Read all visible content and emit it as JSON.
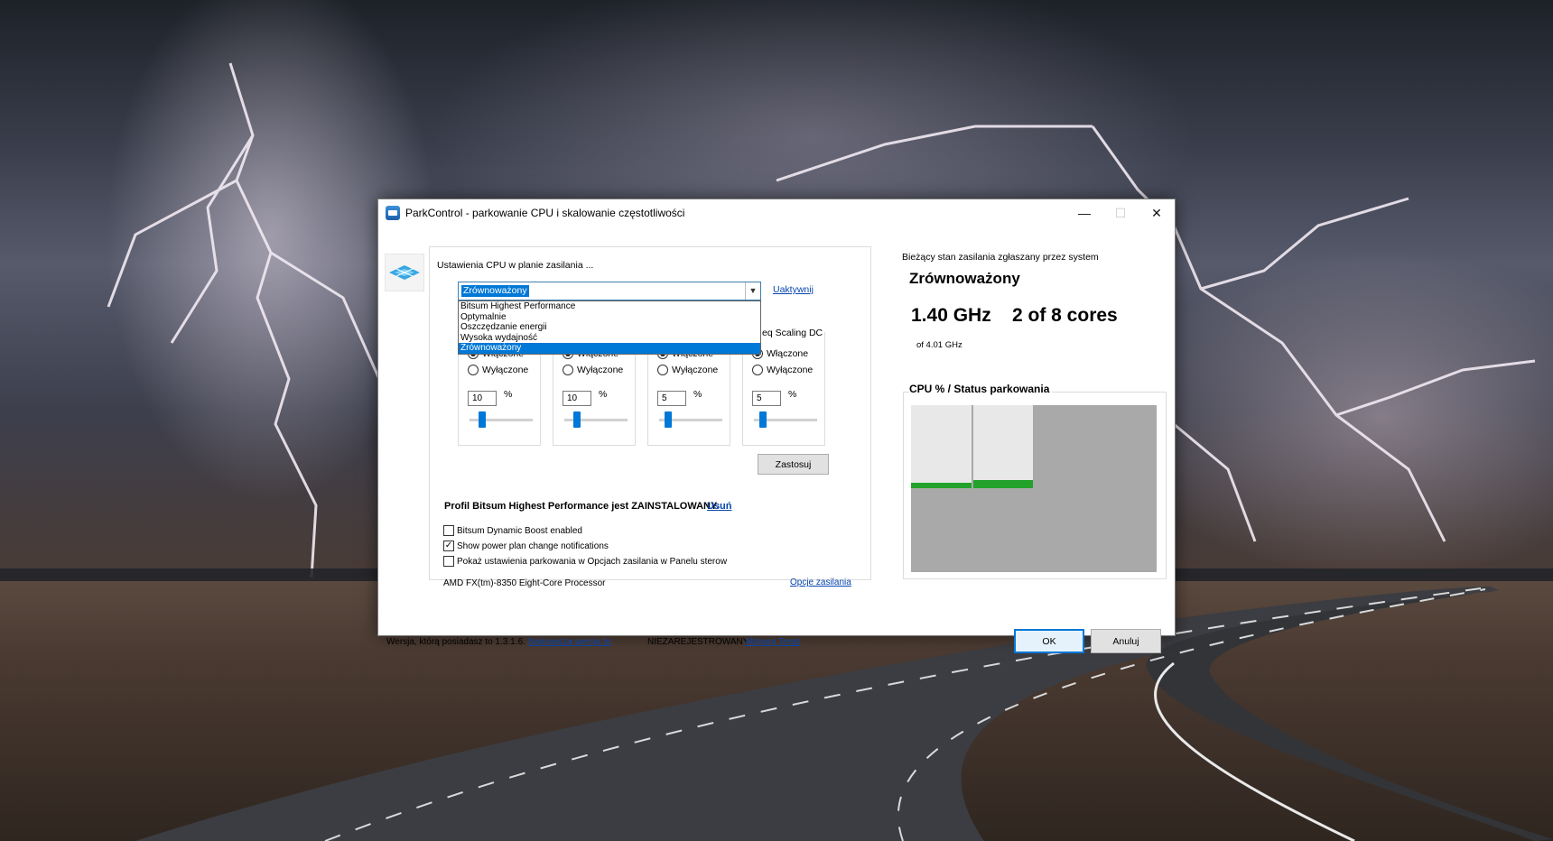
{
  "window": {
    "title": "ParkControl - parkowanie CPU i skalowanie częstotliwości",
    "minimize": "—",
    "maximize": "☐",
    "close": "✕"
  },
  "left": {
    "caption": "Ustawienia CPU w planie zasilania ...",
    "combo_value": "Zrównoważony",
    "activate_link": "Uaktywnij",
    "dropdown_options": [
      "Bitsum Highest Performance",
      "Optymalnie",
      "Oszczędzanie energii",
      "Wysoka wydajność",
      "Zrównoważony"
    ],
    "selected_option": "Zrównoważony",
    "group_caption_partial": "eq Scaling DC",
    "groups": [
      {
        "on_label": "Włączone",
        "off_label": "Wyłączone",
        "on_selected": true,
        "value": "10",
        "pct": "%",
        "slider_level": 0.1
      },
      {
        "on_label": "Włączone",
        "off_label": "Wyłączone",
        "on_selected": true,
        "value": "10",
        "pct": "%",
        "slider_level": 0.1
      },
      {
        "on_label": "Włączone",
        "off_label": "Wyłączone",
        "on_selected": true,
        "value": "5",
        "pct": "%",
        "slider_level": 0.05
      },
      {
        "on_label": "Włączone",
        "off_label": "Wyłączone",
        "on_selected": true,
        "value": "5",
        "pct": "%",
        "slider_level": 0.05
      }
    ],
    "apply_button": "Zastosuj",
    "profile_text": "Profil Bitsum Highest Performance jest ZAINSTALOWANY.",
    "remove_link": "Usuń",
    "checkboxes": [
      {
        "label": "Bitsum Dynamic Boost enabled",
        "checked": false
      },
      {
        "label": "Show power plan change notifications",
        "checked": true
      },
      {
        "label": "Pokaż ustawienia parkowania w Opcjach zasilania w Panelu sterow",
        "checked": false
      }
    ],
    "cpu_name": "AMD FX(tm)-8350 Eight-Core Processor",
    "power_options_link": "Opcje zasilania"
  },
  "right": {
    "status_label": "Bieżący stan zasilania zgłaszany przez system",
    "plan_name": "Zrównoważony",
    "frequency": "1.40 GHz",
    "cores": "2 of 8 cores",
    "max_freq": "of 4.01 GHz",
    "cpu_caption": "CPU % / Status parkowania",
    "core_usage": [
      {
        "parked": false,
        "usage": 0.06
      },
      {
        "parked": false,
        "usage": 0.09
      },
      {
        "parked": true,
        "usage": 0
      },
      {
        "parked": true,
        "usage": 0
      },
      {
        "parked": true,
        "usage": 0
      },
      {
        "parked": true,
        "usage": 0
      },
      {
        "parked": true,
        "usage": 0
      },
      {
        "parked": true,
        "usage": 0
      }
    ]
  },
  "footer": {
    "version_text": "Wersja, którą posiadasz to 1.3.1.6.",
    "newest_link": "Najnowsza wersja to",
    "unregistered": "NIEZAREJESTROWANY -",
    "activate_now": "Aktywuj Teraz",
    "ok": "OK",
    "cancel": "Anuluj"
  },
  "colors": {
    "accent": "#0078d7",
    "core_bar": "#22a22a",
    "parked_core": "#a9a9a9"
  }
}
